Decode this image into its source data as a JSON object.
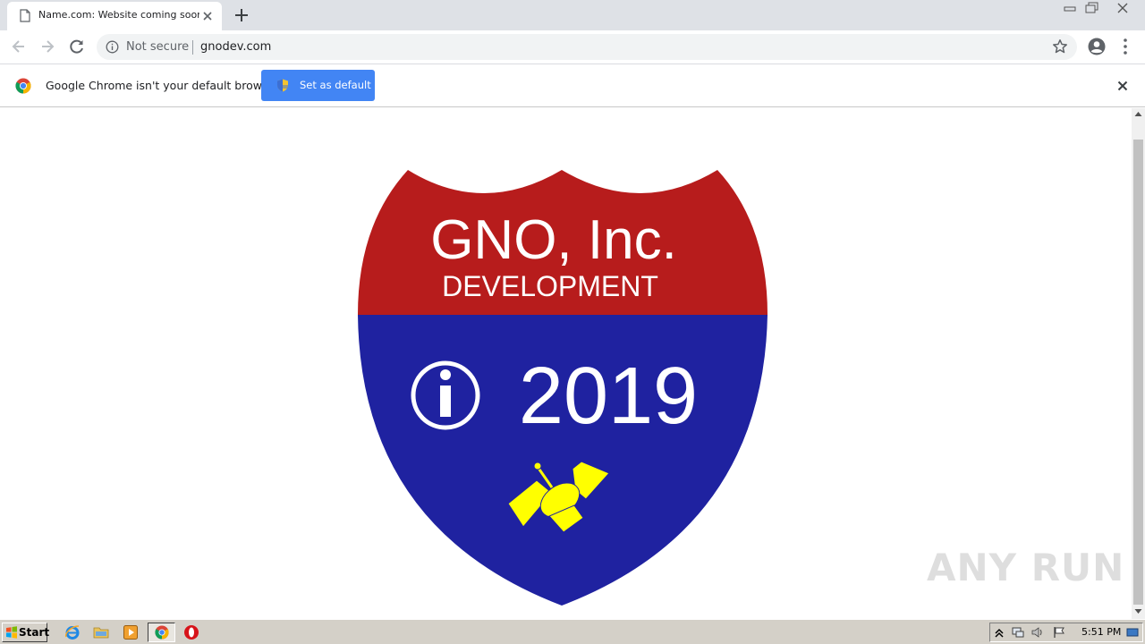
{
  "browser": {
    "tab_title": "Name.com: Website coming soon!",
    "security_label": "Not secure",
    "url": "gnodev.com"
  },
  "infobar": {
    "message": "Google Chrome isn't your default browser",
    "button_label": "Set as default"
  },
  "page": {
    "company": "GNO, Inc.",
    "subtitle": "DEVELOPMENT",
    "year": "2019",
    "colors": {
      "red": "#b71c1c",
      "blue": "#1f22a0",
      "yellow": "#ffff00"
    }
  },
  "watermark": "ANY RUN",
  "taskbar": {
    "start_label": "Start",
    "clock": "5:51 PM"
  },
  "icons": [
    "page-icon",
    "close-icon",
    "plus-icon",
    "back-arrow-icon",
    "forward-arrow-icon",
    "reload-icon",
    "info-icon",
    "star-icon",
    "account-icon",
    "kebab-menu-icon",
    "chrome-logo-icon",
    "uac-shield-icon",
    "windows-flag-icon",
    "internet-explorer-icon",
    "folder-icon",
    "media-player-icon",
    "opera-icon",
    "network-icon",
    "volume-icon",
    "action-center-flag-icon"
  ]
}
